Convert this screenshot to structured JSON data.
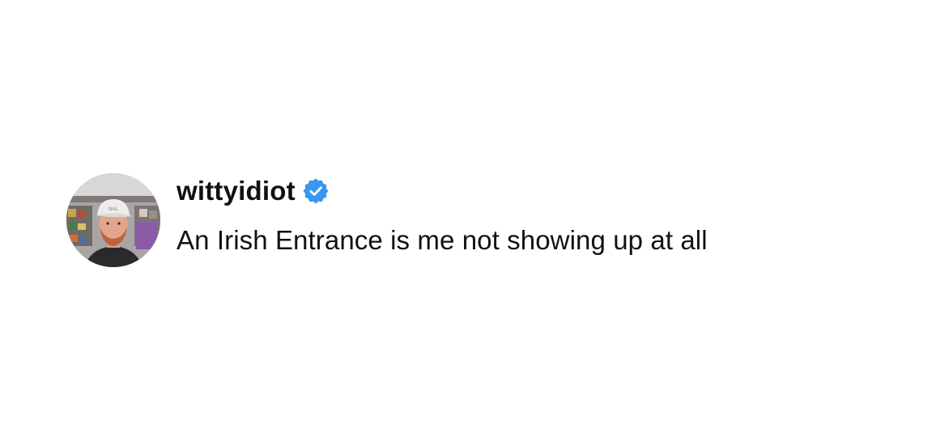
{
  "post": {
    "avatar_icon": "profile-photo",
    "username": "wittyidiot",
    "verified_icon": "verified-badge-icon",
    "verified_color": "#3897f0",
    "text": "An Irish Entrance is me not showing up at all"
  }
}
